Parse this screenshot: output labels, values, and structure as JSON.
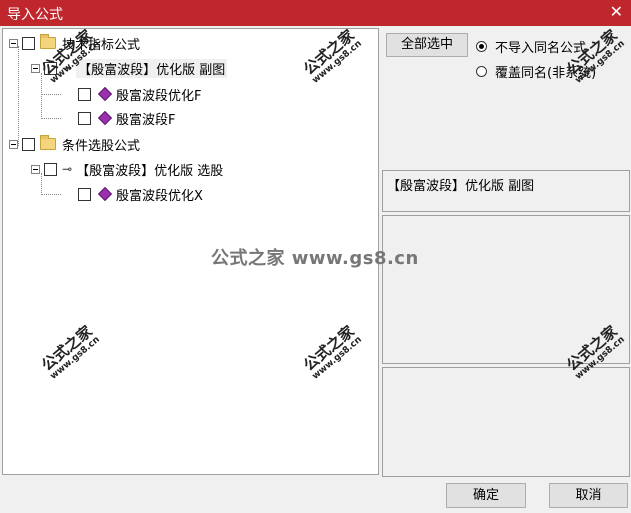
{
  "window": {
    "title": "导入公式",
    "close_glyph": "✕"
  },
  "tree": {
    "groups": [
      {
        "label": "技术指标公式",
        "items": [
          {
            "label": "【殷富波段】优化版 副图",
            "children": [
              {
                "label": "殷富波段优化F"
              },
              {
                "label": "殷富波段F"
              }
            ]
          }
        ]
      },
      {
        "label": "条件选股公式",
        "items": [
          {
            "label": "【殷富波段】优化版 选股",
            "children": [
              {
                "label": "殷富波段优化X"
              }
            ]
          }
        ]
      }
    ]
  },
  "options": {
    "select_all_label": "全部选中",
    "radio_skip_label": "不导入同名公式",
    "radio_overwrite_label": "覆盖同名(非系统)",
    "selected_radio": "skip"
  },
  "selected_formula": "【殷富波段】优化版 副图",
  "buttons": {
    "ok_label": "确定",
    "cancel_label": "取消"
  },
  "watermark": {
    "text_big": "公式之家",
    "text_small": "www.gs8.cn",
    "center_text": "公式之家 www.gs8.cn"
  },
  "colors": {
    "titlebar": "#c0272d",
    "gem_icon": "#9b2fb0",
    "folder": "#f4d47c"
  }
}
